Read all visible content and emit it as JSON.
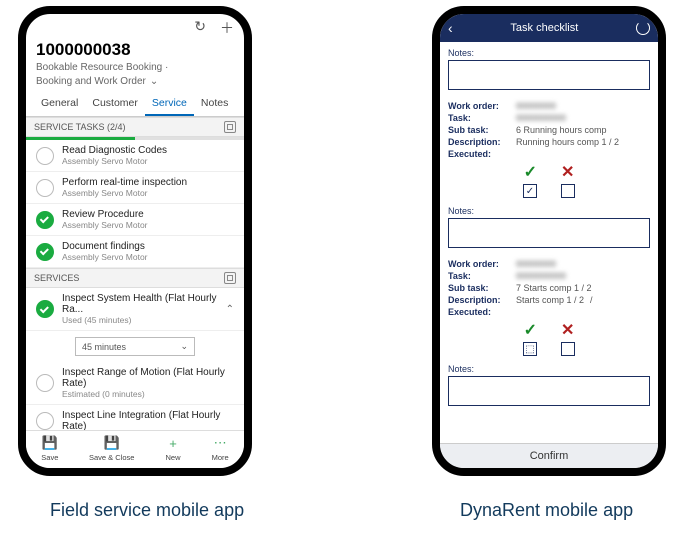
{
  "captions": {
    "left": "Field service mobile app",
    "right": "DynaRent mobile app"
  },
  "field_service": {
    "record_id": "1000000038",
    "breadcrumb_line1": "Bookable Resource Booking ·",
    "breadcrumb_line2": "Booking and Work Order",
    "tabs": [
      "General",
      "Customer",
      "Service",
      "Notes"
    ],
    "active_tab": "Service",
    "sections": {
      "tasks_header": "SERVICE TASKS (2/4)",
      "services_header": "SERVICES"
    },
    "tasks": [
      {
        "title": "Read Diagnostic Codes",
        "sub": "Assembly Servo Motor",
        "done": false
      },
      {
        "title": "Perform real-time inspection",
        "sub": "Assembly Servo Motor",
        "done": false
      },
      {
        "title": "Review Procedure",
        "sub": "Assembly Servo Motor",
        "done": true
      },
      {
        "title": "Document findings",
        "sub": "Assembly Servo Motor",
        "done": true
      }
    ],
    "services": [
      {
        "title": "Inspect System Health (Flat Hourly Ra...",
        "sub": "Used (45 minutes)",
        "done": true,
        "expanded": true,
        "duration": "45 minutes"
      },
      {
        "title": "Inspect Range of Motion (Flat Hourly Rate)",
        "sub": "Estimated (0 minutes)",
        "done": false
      },
      {
        "title": "Inspect Line Integration (Flat Hourly Rate)",
        "sub": "",
        "done": false
      }
    ],
    "bottom_bar": [
      {
        "label": "Save",
        "icon": "💾"
      },
      {
        "label": "Save & Close",
        "icon": "💾"
      },
      {
        "label": "New",
        "icon": "+"
      },
      {
        "label": "More",
        "icon": "⋯"
      }
    ]
  },
  "dynarent": {
    "header_title": "Task checklist",
    "top_notes_label": "Notes:",
    "confirm_label": "Confirm",
    "items": [
      {
        "work_order_label": "Work order:",
        "task_label": "Task:",
        "sub_task_label": "Sub task:",
        "description_label": "Description:",
        "executed_label": "Executed:",
        "notes_label": "Notes:",
        "sub_task": "6 Running hours comp",
        "description": "Running hours comp 1 / 2",
        "checked": true
      },
      {
        "work_order_label": "Work order:",
        "task_label": "Task:",
        "sub_task_label": "Sub task:",
        "description_label": "Description:",
        "executed_label": "Executed:",
        "notes_label": "Notes:",
        "sub_task": "7 Starts comp 1 / 2",
        "description": "Starts comp 1 / 2",
        "checked": false
      }
    ]
  }
}
